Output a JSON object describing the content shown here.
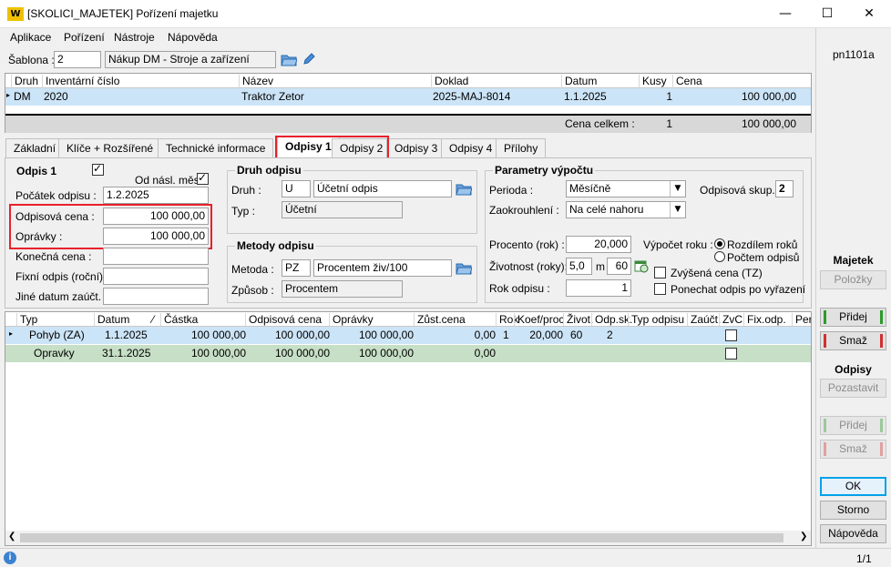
{
  "window": {
    "logo": "W",
    "title": "[SKOLICI_MAJETEK] Pořízení majetku",
    "min": "—",
    "max": "☐",
    "close": "✕"
  },
  "menu": [
    "Aplikace",
    "Pořízení",
    "Nástroje",
    "Nápověda"
  ],
  "form_code": "pn1101a",
  "template": {
    "label": "Šablona :",
    "code": "2",
    "name": "Nákup DM - Stroje a zařízení"
  },
  "top_grid": {
    "columns": [
      "Druh",
      "Inventární číslo",
      "Název",
      "Doklad",
      "Datum",
      "Kusy",
      "Cena"
    ],
    "row": {
      "marker": "▸",
      "druh": "DM",
      "inv": "2020",
      "nazev": "Traktor Zetor",
      "doklad": "2025-MAJ-8014",
      "datum": "1.1.2025",
      "kusy": "1",
      "cena": "100 000,00"
    },
    "total_label": "Cena celkem :",
    "total_kusy": "1",
    "total_cena": "100 000,00"
  },
  "tabs": [
    "Základní",
    "Klíče + Rozšířené",
    "Technické informace",
    "Odpisy 1",
    "Odpisy 2",
    "Odpisy 3",
    "Odpisy 4",
    "Přílohy"
  ],
  "odpis": {
    "title": "Odpis 1",
    "od_nasl": "Od násl. měs.",
    "pocatek_label": "Počátek odpisu :",
    "pocatek": "1.2.2025",
    "cena_label": "Odpisová cena :",
    "cena": "100 000,00",
    "opravky_label": "Oprávky :",
    "opravky": "100 000,00",
    "konecna_label": "Konečná cena :",
    "konecna": "",
    "fixni_label": "Fixní odpis (roční) :",
    "fixni": "",
    "jine_label": "Jiné datum zaúčt. :",
    "jine": ""
  },
  "druh_odpisu": {
    "title": "Druh odpisu",
    "druh_label": "Druh :",
    "druh_code": "U",
    "druh_name": "Účetní odpis",
    "typ_label": "Typ :",
    "typ": "Účetní"
  },
  "metody": {
    "title": "Metody odpisu",
    "metoda_label": "Metoda :",
    "metoda_code": "PZ",
    "metoda_name": "Procentem živ/100",
    "zpusob_label": "Způsob :",
    "zpusob": "Procentem"
  },
  "parametry": {
    "title": "Parametry výpočtu",
    "perioda_label": "Perioda :",
    "perioda": "Měsíčně",
    "skup_label": "Odpisová skup. :",
    "skup": "2",
    "zaokr_label": "Zaokrouhlení :",
    "zaokr": "Na celé nahoru",
    "procento_label": "Procento (rok) :",
    "procento": "20,000",
    "vypocet_label": "Výpočet roku :",
    "radio1": "Rozdílem roků",
    "radio2": "Počtem odpisů",
    "zivotnost_label": "Životnost (roky):",
    "zivotnost": "5,0",
    "m_label": "m",
    "mesice": "60",
    "zvysena": "Zvýšená cena (TZ)",
    "rok_label": "Rok odpisu :",
    "rok": "1",
    "ponechat": "Ponechat odpis po vyřazení"
  },
  "bottom_grid": {
    "columns": [
      "Typ",
      "Datum",
      "Částka",
      "Odpisová cena",
      "Oprávky",
      "Zůst.cena",
      "Rok",
      "Koef/proc",
      "Život.",
      "Odp.sk.",
      "Typ odpisu",
      "Zaúčt.",
      "ZvC",
      "Fix.odp.",
      "Per"
    ],
    "sort_indicator": "⁄",
    "rows": [
      {
        "marker": "▸",
        "typ": "Pohyb (ZA)",
        "datum": "1.1.2025",
        "castka": "100 000,00",
        "cena": "100 000,00",
        "opravky": "100 000,00",
        "zust": "0,00",
        "rok": "1",
        "koef": "20,000",
        "zivot": "60",
        "odpsk": "2"
      },
      {
        "marker": "",
        "typ": "Opravky",
        "datum": "31.1.2025",
        "castka": "100 000,00",
        "cena": "100 000,00",
        "opravky": "100 000,00",
        "zust": "0,00",
        "rok": "",
        "koef": "",
        "zivot": "",
        "odpsk": ""
      }
    ]
  },
  "sidebar": {
    "majetek": "Majetek",
    "polozky": "Položky",
    "pridej": "Přidej",
    "smaz": "Smaž",
    "odpisy": "Odpisy",
    "pozastavit": "Pozastavit",
    "pridej2": "Přidej",
    "smaz2": "Smaž",
    "ok": "OK",
    "storno": "Storno",
    "napoveda": "Nápověda"
  },
  "status": {
    "info": "i",
    "page": "1/1"
  },
  "colors": {
    "selected_row": "#cce4f7",
    "green_row": "#c6dfc6",
    "highlight": "#e8212b",
    "ok_border": "#00a2e8"
  }
}
